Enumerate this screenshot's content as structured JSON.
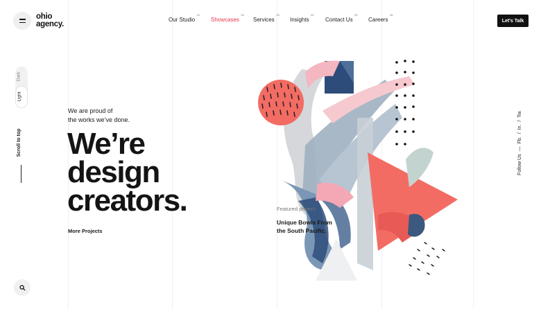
{
  "logo": {
    "line1": "ohio",
    "line2": "agency."
  },
  "nav": [
    {
      "label": "Our Studio",
      "num": "01"
    },
    {
      "label": "Showcases",
      "num": "02"
    },
    {
      "label": "Services",
      "num": "03"
    },
    {
      "label": "Insights",
      "num": "04"
    },
    {
      "label": "Contact Us",
      "num": "05"
    },
    {
      "label": "Careers",
      "num": "06"
    }
  ],
  "cta_label": "Let's Talk",
  "theme_toggle": {
    "dark": "Dark",
    "light": "Light"
  },
  "scroll_to_top": "Scroll to top",
  "intro": {
    "line1": "We are proud of",
    "line2": "the works we’ve done."
  },
  "headline": {
    "line1": "We’re",
    "line2": "design",
    "line3": "creators."
  },
  "more_projects": "More Projects",
  "featured": {
    "label": "Featured project:",
    "title_line1": "Unique Bowls From",
    "title_line2": "the South Pacific."
  },
  "social": {
    "prefix": "Follow Us",
    "dash": "—",
    "fb": "Fb.",
    "in": "In.",
    "tw": "Tw.",
    "sep": "/"
  },
  "colors": {
    "accent": "#e6354a",
    "dark": "#111111",
    "coral": "#f26c63",
    "navy": "#2e4c7a",
    "pink": "#f2a8b4"
  }
}
